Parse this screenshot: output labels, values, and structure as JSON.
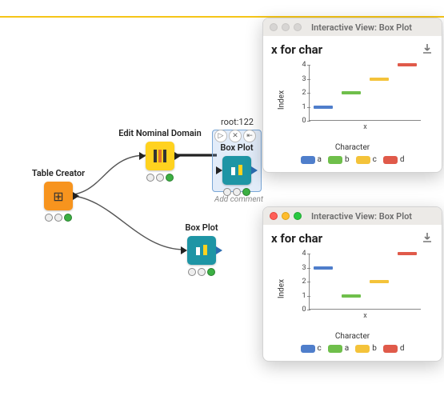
{
  "palette": {
    "blue": "#4f7ecb",
    "green": "#6fbf4b",
    "yellow": "#f4c33a",
    "red": "#e05a4a"
  },
  "workflow": {
    "root_label": "root:122",
    "add_comment": "Add comment",
    "nodes": {
      "table_creator": {
        "label": "Table Creator"
      },
      "edit_nominal": {
        "label": "Edit Nominal Domain"
      },
      "box_plot_top": {
        "label": "Box Plot"
      },
      "box_plot_bot": {
        "label": "Box Plot"
      }
    }
  },
  "panels": [
    {
      "id": "panel1",
      "chrome_title": "Interactive View: Box Plot",
      "active": false,
      "chart_ref": 0
    },
    {
      "id": "panel2",
      "chrome_title": "Interactive View: Box Plot",
      "active": true,
      "chart_ref": 1
    }
  ],
  "chart_data": [
    {
      "type": "bar",
      "title": "x for char",
      "xlabel": "Character",
      "ylabel": "Index",
      "xticks": [
        "x"
      ],
      "ylim": [
        0,
        4
      ],
      "categories": [
        "a",
        "b",
        "c",
        "d"
      ],
      "values": [
        1,
        2,
        3,
        4
      ],
      "colors": [
        "blue",
        "green",
        "yellow",
        "red"
      ]
    },
    {
      "type": "bar",
      "title": "x for char",
      "xlabel": "Character",
      "ylabel": "Index",
      "xticks": [
        "x"
      ],
      "ylim": [
        0,
        4
      ],
      "categories": [
        "c",
        "a",
        "b",
        "d"
      ],
      "values": [
        3,
        1,
        2,
        4
      ],
      "colors": [
        "blue",
        "green",
        "yellow",
        "red"
      ]
    }
  ]
}
